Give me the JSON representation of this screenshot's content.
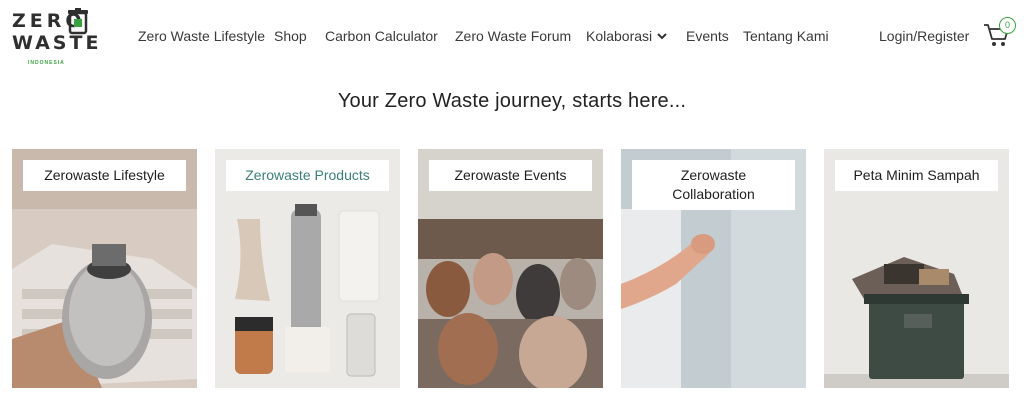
{
  "header": {
    "logo": {
      "line1": "ZERO",
      "line2": "WASTE",
      "sub": "INDONESIA"
    },
    "nav": [
      {
        "label": "Zero Waste Lifestyle"
      },
      {
        "label": "Shop"
      },
      {
        "label": "Carbon Calculator"
      },
      {
        "label": "Zero Waste Forum"
      },
      {
        "label": "Kolaborasi",
        "dropdown": true
      },
      {
        "label": "Events"
      },
      {
        "label": "Tentang Kami"
      }
    ],
    "login_label": "Login/Register",
    "cart_count": "0"
  },
  "hero": {
    "tagline": "Your Zero Waste journey, starts here..."
  },
  "cards": [
    {
      "label": "Zerowaste Lifestyle"
    },
    {
      "label": "Zerowaste Products"
    },
    {
      "label": "Zerowaste Events"
    },
    {
      "label": "Zerowaste Collaboration"
    },
    {
      "label": "Peta Minim Sampah"
    }
  ],
  "colors": {
    "brand_green": "#3aa341",
    "products_label": "#3b7f7a",
    "text": "#3a3a3a"
  }
}
